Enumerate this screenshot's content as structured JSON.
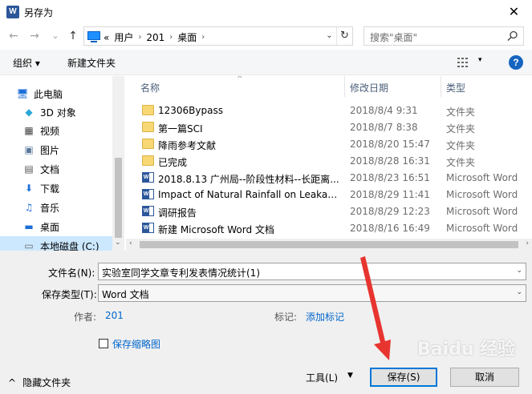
{
  "window": {
    "title": "另存为",
    "app_icon_letter": "W",
    "close_glyph": "✕"
  },
  "nav": {
    "back": "←",
    "forward": "→",
    "recent": "⌄",
    "up": "↑"
  },
  "address": {
    "prefix": "«",
    "crumbs": [
      "用户",
      "201",
      "桌面"
    ],
    "separator": "›",
    "dropdown": "⌄",
    "refresh": "↻"
  },
  "search": {
    "placeholder": "搜索\"桌面\""
  },
  "toolbar": {
    "organize": "组织 ▾",
    "new_folder": "新建文件夹",
    "view_drop": "▾",
    "help": "?"
  },
  "sidebar": {
    "items": [
      {
        "label": "此电脑",
        "icon": "pc-icon",
        "glyph": "🖥"
      },
      {
        "label": "3D 对象",
        "icon": "cube-icon",
        "glyph": "◆"
      },
      {
        "label": "视频",
        "icon": "video-icon",
        "glyph": "▦"
      },
      {
        "label": "图片",
        "icon": "picture-icon",
        "glyph": "▣"
      },
      {
        "label": "文档",
        "icon": "document-icon",
        "glyph": "▤"
      },
      {
        "label": "下载",
        "icon": "download-icon",
        "glyph": "⬇"
      },
      {
        "label": "音乐",
        "icon": "music-icon",
        "glyph": "♫"
      },
      {
        "label": "桌面",
        "icon": "desktop-icon",
        "glyph": "▬"
      },
      {
        "label": "本地磁盘 (C:)",
        "icon": "drive-icon",
        "glyph": "▭"
      }
    ],
    "selected_index": 8,
    "scroll_down": "⌄"
  },
  "files": {
    "columns": [
      "名称",
      "修改日期",
      "类型"
    ],
    "sort_arrow": "^",
    "rows": [
      {
        "name": "12306Bypass",
        "date": "2018/8/4 9:31",
        "type": "文件夹",
        "kind": "folder"
      },
      {
        "name": "第一篇SCI",
        "date": "2018/8/7 8:38",
        "type": "文件夹",
        "kind": "folder"
      },
      {
        "name": "降雨参考文献",
        "date": "2018/8/20 15:47",
        "type": "文件夹",
        "kind": "folder"
      },
      {
        "name": "已完成",
        "date": "2018/8/28 16:31",
        "type": "文件夹",
        "kind": "folder"
      },
      {
        "name": "2018.8.13 广州局--阶段性材料--长距离...",
        "date": "2018/8/23 16:51",
        "type": "Microsoft Word",
        "kind": "doc"
      },
      {
        "name": "Impact of Natural Rainfall on Leakag...",
        "date": "2018/8/29 11:41",
        "type": "Microsoft Word",
        "kind": "doc"
      },
      {
        "name": "调研报告",
        "date": "2018/8/29 12:23",
        "type": "Microsoft Word",
        "kind": "doc"
      },
      {
        "name": "新建 Microsoft Word 文档",
        "date": "2018/8/16 16:49",
        "type": "Microsoft Word",
        "kind": "doc"
      }
    ],
    "scroll_left": "‹",
    "scroll_right": "›"
  },
  "form": {
    "filename_label": "文件名(N):",
    "filename_value": "实验室同学文章专利发表情况统计(1)",
    "filetype_label": "保存类型(T):",
    "filetype_value": "Word 文档",
    "combo_drop": "⌄",
    "author_label": "作者:",
    "author_value": "201",
    "tags_label": "标记:",
    "tags_value": "添加标记",
    "thumbnail_label": "保存缩略图"
  },
  "footer": {
    "hide_folders": "隐藏文件夹",
    "hide_chevron": "^",
    "tools": "工具(L)",
    "tools_drop": "▼",
    "save": "保存(S)",
    "cancel": "取消"
  },
  "watermark": {
    "text": "Baidu 经验"
  },
  "colors": {
    "accent": "#0078d7",
    "arrow": "#e8342f",
    "selected": "#cce8ff"
  }
}
